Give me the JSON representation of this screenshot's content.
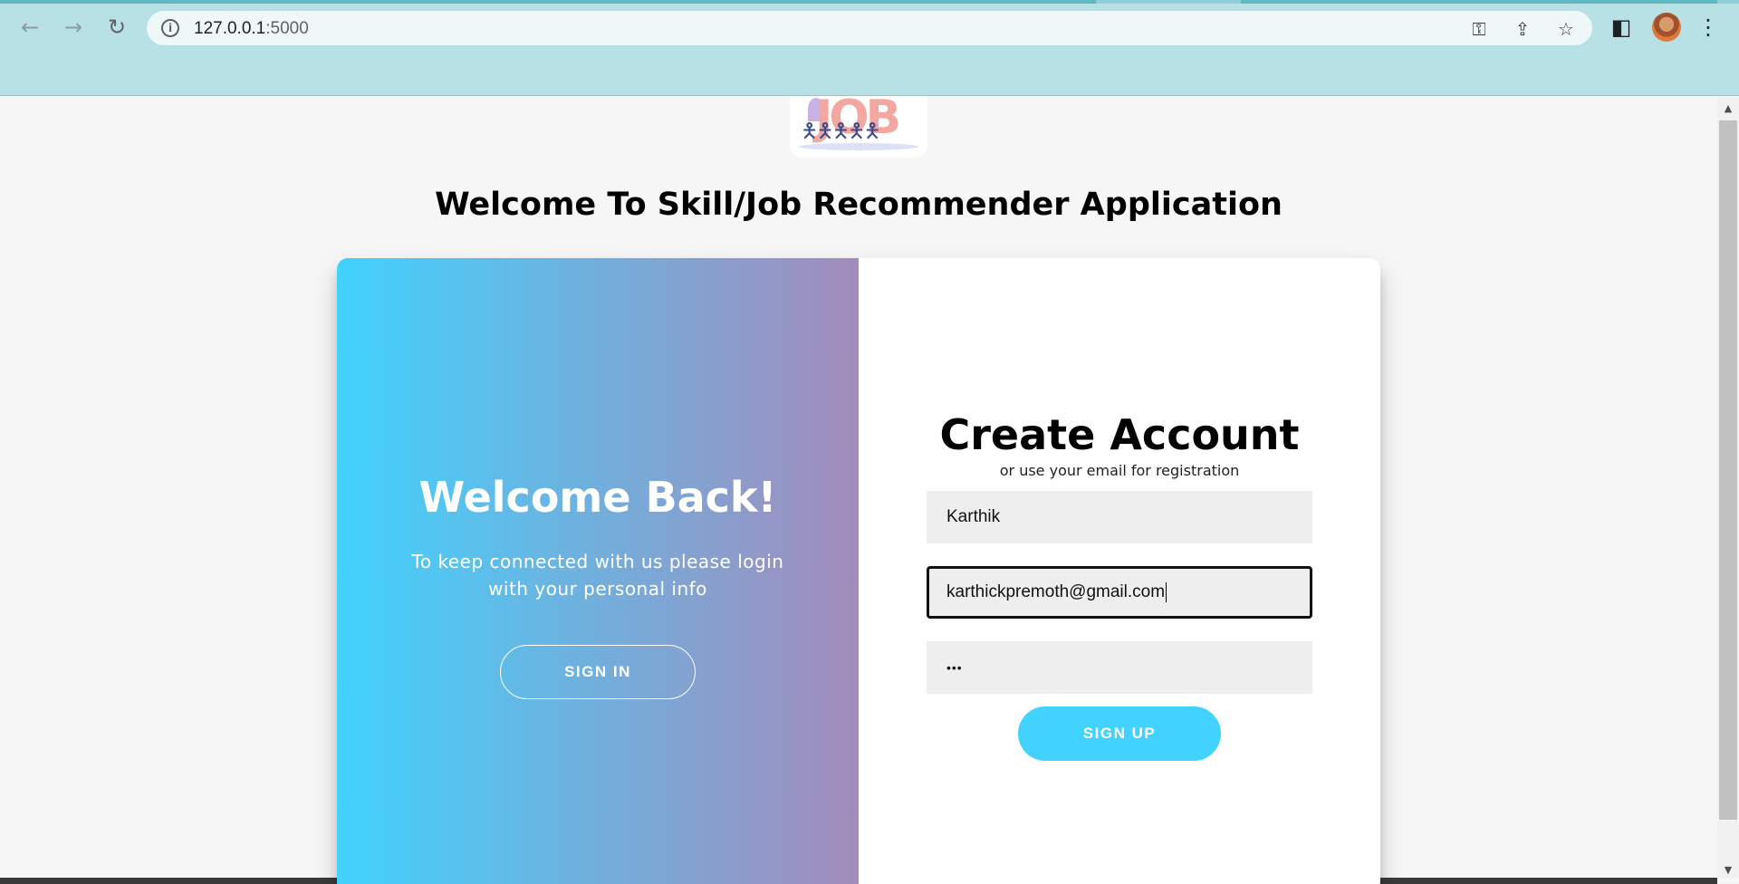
{
  "browser": {
    "url_host": "127.0.0.1",
    "url_port": ":5000",
    "back_icon": "←",
    "forward_icon": "→",
    "reload_icon": "↻",
    "info_icon": "i",
    "key_icon": "⚿",
    "share_icon": "⇪",
    "star_icon": "☆",
    "sidepanel_icon": "◧",
    "menu_icon": "⋮"
  },
  "page": {
    "logo_text": "JOB",
    "welcome_title": "Welcome To Skill/Job Recommender Application"
  },
  "overlay": {
    "title": "Welcome Back!",
    "text": "To keep connected with us please login with your personal info",
    "sign_in_label": "SIGN IN"
  },
  "form": {
    "title": "Create Account",
    "subtitle": "or use your email for registration",
    "name_value": "Karthik",
    "email_value": "karthickpremoth@gmail.com",
    "password_mask": "•••",
    "sign_up_label": "SIGN UP"
  },
  "colors": {
    "chrome_bar": "#b8e1e6",
    "gradient_start": "#41d2fd",
    "gradient_end": "#a38bbb",
    "primary_button": "#41d2fd"
  }
}
